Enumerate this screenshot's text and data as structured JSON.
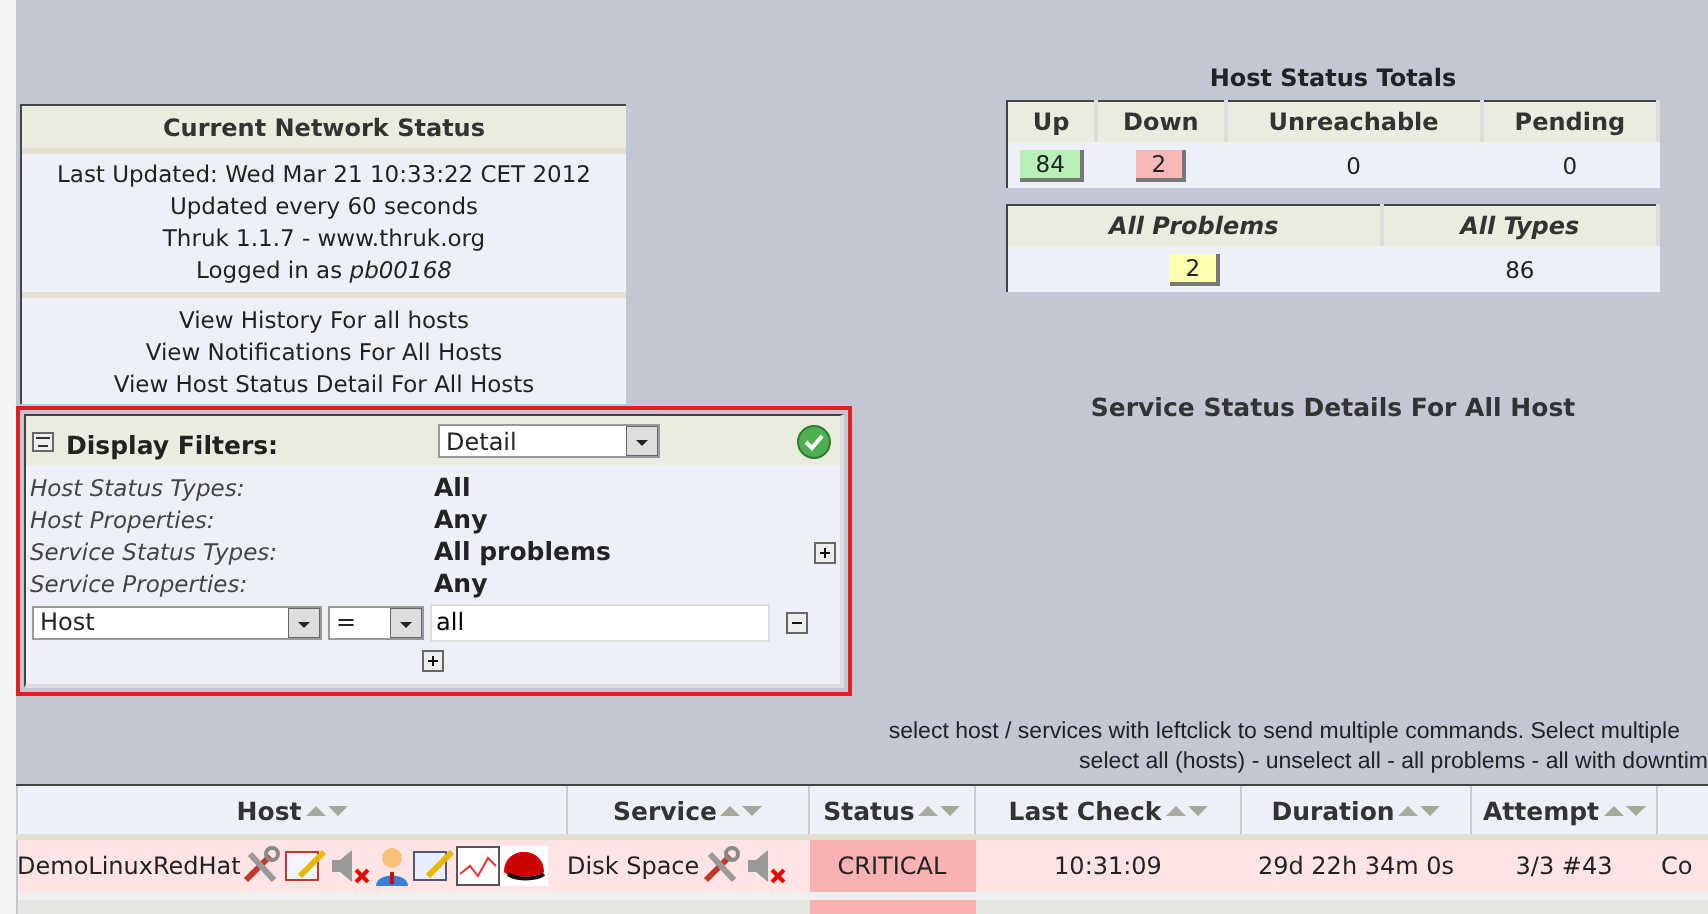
{
  "network_status": {
    "title": "Current Network Status",
    "last_updated": "Last Updated: Wed Mar 21 10:33:22 CET 2012",
    "refresh": "Updated every 60 seconds",
    "version": "Thruk 1.1.7 - www.thruk.org",
    "logged_in_label": "Logged in as",
    "user": "pb00168",
    "links": [
      "View History For all hosts",
      "View Notifications For All Hosts",
      "View Host Status Detail For All Hosts"
    ]
  },
  "filters": {
    "title": "Display Filters:",
    "view": "Detail",
    "rows": [
      {
        "label": "Host Status Types:",
        "value": "All"
      },
      {
        "label": "Host Properties:",
        "value": "Any"
      },
      {
        "label": "Service Status Types:",
        "value": "All problems"
      },
      {
        "label": "Service Properties:",
        "value": "Any"
      }
    ],
    "filter": {
      "field": "Host",
      "operator": "=",
      "value": "all"
    }
  },
  "host_totals": {
    "title": "Host Status Totals",
    "columns": [
      {
        "label": "Up",
        "value": "84",
        "color": "#b8f0b8"
      },
      {
        "label": "Down",
        "value": "2",
        "color": "#f8b8b8"
      },
      {
        "label": "Unreachable",
        "value": "0"
      },
      {
        "label": "Pending",
        "value": "0"
      }
    ]
  },
  "problem_totals": {
    "columns": [
      {
        "label": "All Problems",
        "value": "2",
        "color": "#ffffb0"
      },
      {
        "label": "All Types",
        "value": "86"
      }
    ]
  },
  "service_title": "Service Status Details For All Host",
  "notes": [
    "select host / services with leftclick to send multiple commands. Select multiple",
    "select all (hosts) - unselect all - all problems - all with downtim"
  ],
  "table": {
    "columns": [
      {
        "label": "Host"
      },
      {
        "label": "Service"
      },
      {
        "label": "Status"
      },
      {
        "label": "Last Check"
      },
      {
        "label": "Duration"
      },
      {
        "label": "Attempt"
      }
    ],
    "rows": [
      {
        "color": "#fee4e4",
        "cells": [
          "DemoLinuxRedHat",
          "Disk Space",
          "CRITICAL",
          "10:31:09",
          "29d 22h 34m 0s",
          "3/3 #43",
          "Co"
        ]
      }
    ]
  }
}
